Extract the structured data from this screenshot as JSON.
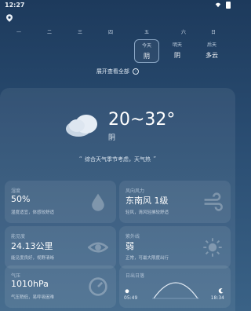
{
  "status_bar": {
    "time": "12:27"
  },
  "week": [
    {
      "day": "一",
      "cond": ""
    },
    {
      "day": "二",
      "cond": ""
    },
    {
      "day": "三",
      "cond": ""
    },
    {
      "day": "四",
      "cond": ""
    },
    {
      "day": "五",
      "cond": ""
    },
    {
      "day": "今天",
      "cond": "阴"
    },
    {
      "day": "明天",
      "cond": "阴"
    },
    {
      "day": "后天",
      "cond": "多云"
    }
  ],
  "week_header_extra": [
    "六",
    "日"
  ],
  "expand_label": "展开查看全部",
  "current": {
    "temp_range": "20~32°",
    "condition": "阴",
    "advice": "综合天气季节考虑，天气热"
  },
  "tiles": {
    "humidity": {
      "title": "湿度",
      "value": "50%",
      "note": "湿度适宜，体感较舒适"
    },
    "wind": {
      "title": "风向风力",
      "value": "东南风 1级",
      "note": "轻风，清风轻拂较舒适"
    },
    "visibility": {
      "title": "能见度",
      "value": "24.13公里",
      "note": "能见度良好，视野清晰"
    },
    "uv": {
      "title": "紫外线",
      "value": "弱",
      "note": "正常，可最大限度出行"
    },
    "pressure": {
      "title": "气压",
      "value": "1010hPa",
      "note": "气压稍低，易呼吸困难"
    },
    "sunrise": {
      "title": "日出日落",
      "sunrise": "05:49",
      "sunset": "18:34"
    }
  }
}
